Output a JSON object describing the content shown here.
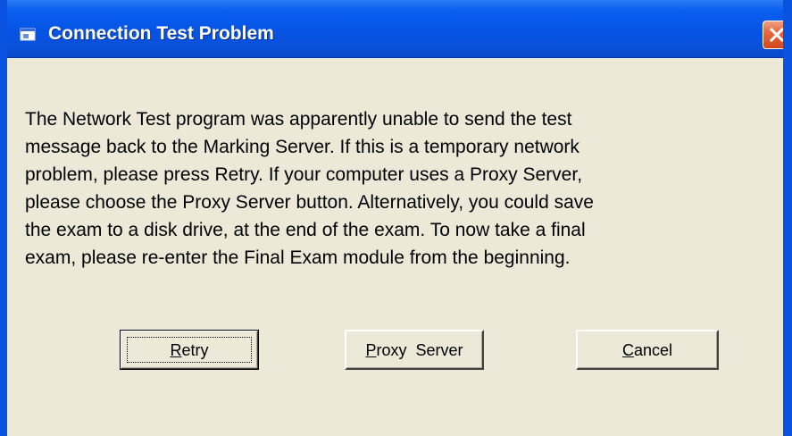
{
  "window": {
    "title": "Connection Test Problem",
    "icon": "app-window-icon",
    "close_icon": "close-icon",
    "colors": {
      "titlebar": "#0654e4",
      "body": "#ece9d8",
      "close_button": "#e36a3f"
    }
  },
  "dialog": {
    "message_lines": [
      "The Network Test program was apparently unable to send the test",
      "message back to the Marking Server. If this is a temporary network",
      "problem, please press Retry.  If your computer uses a Proxy Server,",
      "please choose the Proxy Server button.  Alternatively, you could save",
      "the exam to a disk drive, at the end of the exam.  To now take a final",
      "exam, please re-enter the Final Exam module from the beginning."
    ]
  },
  "buttons": {
    "retry": {
      "mnemonic": "R",
      "rest": "etry"
    },
    "proxy": {
      "mnemonic": "P",
      "rest": "roxy  Server"
    },
    "cancel": {
      "mnemonic": "C",
      "rest": "ancel"
    }
  }
}
